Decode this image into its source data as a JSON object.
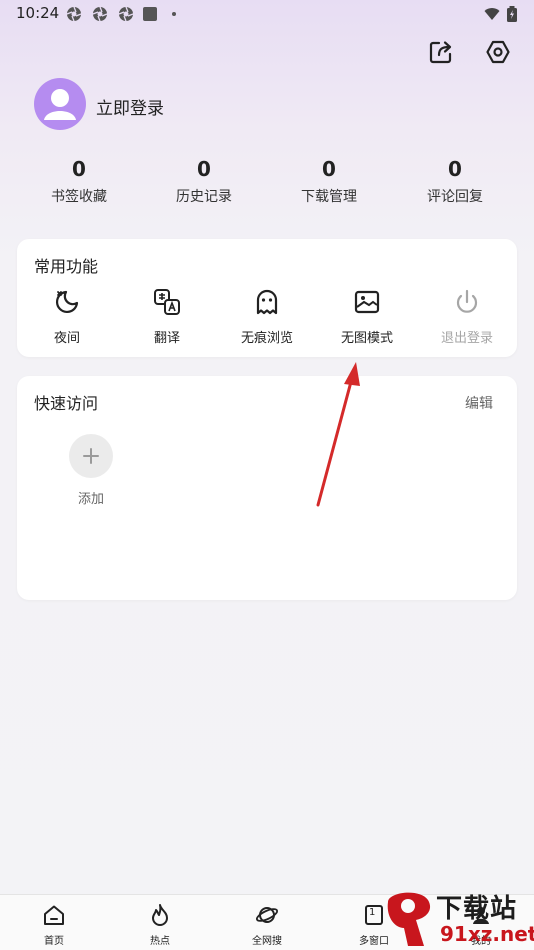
{
  "status_bar": {
    "time": "10:24"
  },
  "profile": {
    "login_label": "立即登录"
  },
  "stats": [
    {
      "value": "0",
      "label": "书签收藏"
    },
    {
      "value": "0",
      "label": "历史记录"
    },
    {
      "value": "0",
      "label": "下载管理"
    },
    {
      "value": "0",
      "label": "评论回复"
    }
  ],
  "common_functions": {
    "title": "常用功能",
    "items": [
      {
        "label": "夜间",
        "icon": "moon-icon",
        "enabled": true
      },
      {
        "label": "翻译",
        "icon": "translate-icon",
        "enabled": true
      },
      {
        "label": "无痕浏览",
        "icon": "ghost-icon",
        "enabled": true
      },
      {
        "label": "无图模式",
        "icon": "image-icon",
        "enabled": true
      },
      {
        "label": "退出登录",
        "icon": "power-icon",
        "enabled": false
      }
    ]
  },
  "quick_access": {
    "title": "快速访问",
    "edit_label": "编辑",
    "add_label": "添加"
  },
  "bottom_nav": [
    {
      "label": "首页",
      "icon": "home-icon"
    },
    {
      "label": "热点",
      "icon": "fire-icon"
    },
    {
      "label": "全网搜",
      "icon": "planet-icon"
    },
    {
      "label": "多窗口",
      "icon": "window-icon",
      "count": "1"
    },
    {
      "label": "我的",
      "icon": "person-icon"
    }
  ],
  "watermark": {
    "text_top": "下载站",
    "text_bottom": "91xz.net"
  },
  "colors": {
    "avatar": "#b58cf0",
    "annotation_arrow": "#d42a2a",
    "watermark_red": "#c8161d"
  }
}
